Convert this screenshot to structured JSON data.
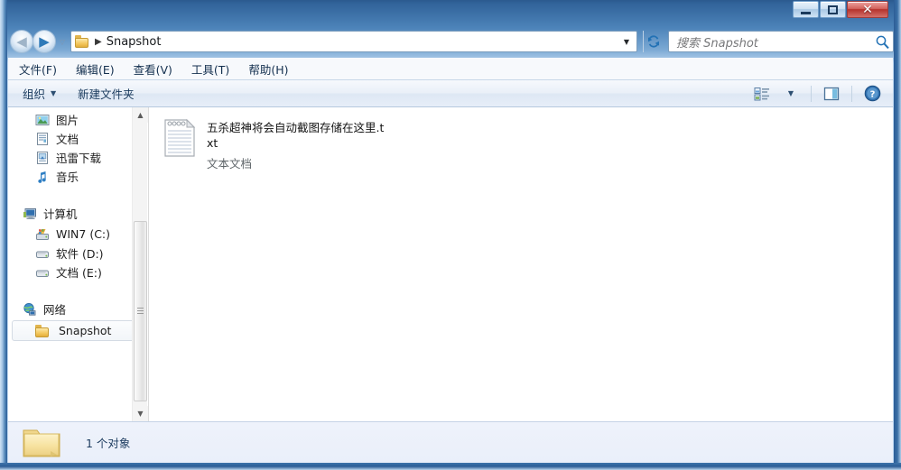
{
  "window": {
    "controls": {
      "minimize_label": "最小化",
      "maximize_label": "最大化",
      "close_label": "关闭",
      "close_glyph": "✕"
    },
    "colors": {
      "titlebar_top": "#2b5a8f",
      "titlebar_bottom": "#b9d4ee",
      "close_button": "#b4322c",
      "frame_border": "#2c5d96",
      "selection_bg": "#f2f5f9"
    }
  },
  "navigation": {
    "back_label": "后退",
    "back_glyph": "◀",
    "forward_label": "前进",
    "forward_glyph": "▶",
    "history_dropdown_glyph": "▽",
    "refresh_label": "刷新"
  },
  "address": {
    "folder_icon": "folder-icon",
    "separator": "▶",
    "path_label": "Snapshot",
    "dropdown_glyph": "▼"
  },
  "search": {
    "placeholder": "搜索 Snapshot",
    "value": "",
    "icon": "search-icon"
  },
  "menubar": {
    "items": [
      {
        "label": "文件(F)"
      },
      {
        "label": "编辑(E)"
      },
      {
        "label": "查看(V)"
      },
      {
        "label": "工具(T)"
      },
      {
        "label": "帮助(H)"
      }
    ]
  },
  "toolbar": {
    "organize_label": "组织",
    "organize_caret": "▼",
    "new_folder_label": "新建文件夹",
    "view_mode_icon": "view-list-icon",
    "view_mode_caret": "▼",
    "preview_pane_icon": "preview-pane-icon",
    "help_icon": "help-icon",
    "help_glyph": "?"
  },
  "sidebar": {
    "scroll": {
      "up_glyph": "▲",
      "down_glyph": "▼"
    },
    "items": [
      {
        "label": "图片",
        "icon": "pictures-icon",
        "type": "item",
        "selected": false
      },
      {
        "label": "文档",
        "icon": "documents-icon",
        "type": "item",
        "selected": false
      },
      {
        "label": "迅雷下载",
        "icon": "download-icon",
        "type": "item",
        "selected": false
      },
      {
        "label": "音乐",
        "icon": "music-icon",
        "type": "item",
        "selected": false
      },
      {
        "label": "计算机",
        "icon": "computer-icon",
        "type": "group",
        "selected": false
      },
      {
        "label": "WIN7 (C:)",
        "icon": "hard-drive-windows-icon",
        "type": "item",
        "selected": false
      },
      {
        "label": "软件 (D:)",
        "icon": "hard-drive-icon",
        "type": "item",
        "selected": false
      },
      {
        "label": "文档 (E:)",
        "icon": "hard-drive-icon",
        "type": "item",
        "selected": false
      },
      {
        "label": "网络",
        "icon": "network-icon",
        "type": "group",
        "selected": false
      },
      {
        "label": "Snapshot",
        "icon": "folder-icon",
        "type": "item",
        "selected": true
      }
    ]
  },
  "files": [
    {
      "name": "五杀超神将会自动截图存储在这里.txt",
      "type_label": "文本文档",
      "icon": "text-file-icon"
    }
  ],
  "statusbar": {
    "folder_icon": "folder-icon",
    "count_label": "1 个对象"
  }
}
